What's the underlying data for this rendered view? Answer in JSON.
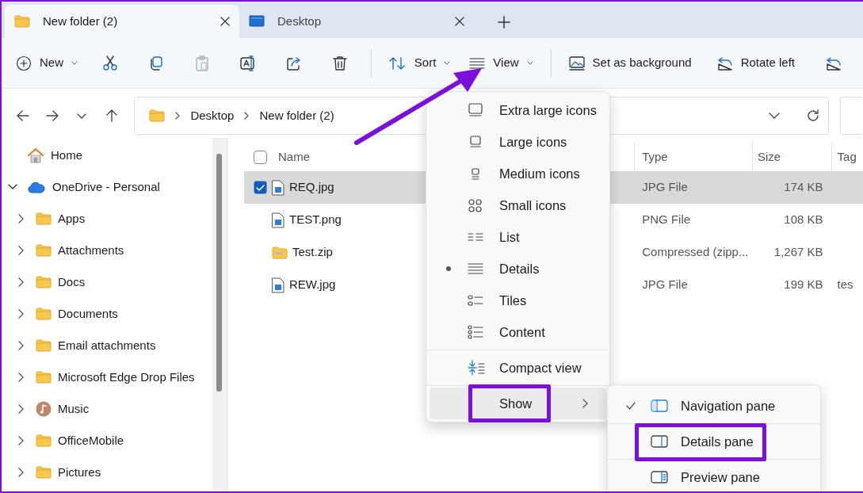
{
  "tabs": [
    {
      "label": "New folder (2)",
      "selected": true
    },
    {
      "label": "Desktop",
      "selected": false
    }
  ],
  "toolbar": {
    "items": [
      {
        "kind": "dropdown",
        "label": "New"
      },
      {
        "kind": "icon",
        "disabled": false
      },
      {
        "kind": "icon",
        "disabled": false
      },
      {
        "kind": "icon",
        "disabled": true
      },
      {
        "kind": "icon",
        "disabled": false
      },
      {
        "kind": "icon",
        "disabled": false
      },
      {
        "kind": "icon",
        "disabled": false
      },
      {
        "kind": "separator"
      },
      {
        "kind": "dropdown",
        "label": "Sort"
      },
      {
        "kind": "dropdown",
        "label": "View"
      },
      {
        "kind": "separator"
      },
      {
        "kind": "button",
        "label": "Set as background"
      },
      {
        "kind": "button",
        "label": "Rotate left"
      },
      {
        "kind": "icon",
        "disabled": false
      }
    ]
  },
  "address_bar": {
    "breadcrumbs": [
      "Desktop",
      "New folder (2)"
    ]
  },
  "nav_pane": {
    "items": [
      {
        "label": "Home",
        "kind": "home"
      },
      {
        "label": "OneDrive - Personal",
        "kind": "cloud",
        "expanded": true,
        "children": [
          {
            "label": "Apps",
            "kind": "folder",
            "expanded": false
          },
          {
            "label": "Attachments",
            "kind": "folder",
            "expanded": false
          },
          {
            "label": "Docs",
            "kind": "folder",
            "expanded": false
          },
          {
            "label": "Documents",
            "kind": "folder",
            "expanded": false
          },
          {
            "label": "Email attachments",
            "kind": "folder",
            "expanded": false
          },
          {
            "label": "Microsoft Edge Drop Files",
            "kind": "folder",
            "expanded": false
          },
          {
            "label": "Music",
            "kind": "music",
            "expanded": false
          },
          {
            "label": "OfficeMobile",
            "kind": "folder",
            "expanded": false
          },
          {
            "label": "Pictures",
            "kind": "folder",
            "expanded": false
          }
        ]
      }
    ]
  },
  "file_list": {
    "select_all": {
      "checked": false
    },
    "columns": [
      "Name",
      "Type",
      "Size",
      "Tag"
    ],
    "rows": [
      {
        "name": "REQ.jpg",
        "kind": "image",
        "type": "JPG File",
        "size": "174 KB",
        "selected": true
      },
      {
        "name": "TEST.png",
        "kind": "image",
        "type": "PNG File",
        "size": "108 KB",
        "selected": false
      },
      {
        "name": "Test.zip",
        "kind": "zip",
        "type": "Compressed (zipp...",
        "size": "1,267 KB",
        "selected": false
      },
      {
        "name": "REW.jpg",
        "kind": "image",
        "type": "JPG File",
        "size": "199 KB",
        "tags": "tes",
        "selected": false
      }
    ]
  },
  "view_menu": {
    "items": [
      {
        "kind": "option",
        "label": "Extra large icons",
        "selected": false
      },
      {
        "kind": "option",
        "label": "Large icons",
        "selected": false
      },
      {
        "kind": "option",
        "label": "Medium icons",
        "selected": false
      },
      {
        "kind": "option",
        "label": "Small icons",
        "selected": false
      },
      {
        "kind": "option",
        "label": "List",
        "selected": false
      },
      {
        "kind": "option",
        "label": "Details",
        "selected": true
      },
      {
        "kind": "option",
        "label": "Tiles",
        "selected": false
      },
      {
        "kind": "option",
        "label": "Content",
        "selected": false
      },
      {
        "kind": "separator"
      },
      {
        "kind": "toggle",
        "label": "Compact view"
      },
      {
        "kind": "separator"
      },
      {
        "kind": "submenu",
        "label": "Show",
        "hovered": true,
        "annotated": true
      }
    ]
  },
  "show_submenu": {
    "items": [
      {
        "label": "Navigation pane",
        "checked": true,
        "annotated": false
      },
      {
        "label": "Details pane",
        "checked": false,
        "annotated": true
      },
      {
        "label": "Preview pane",
        "checked": false,
        "annotated": false
      }
    ]
  },
  "annotation_arrow": {
    "visible": true
  }
}
